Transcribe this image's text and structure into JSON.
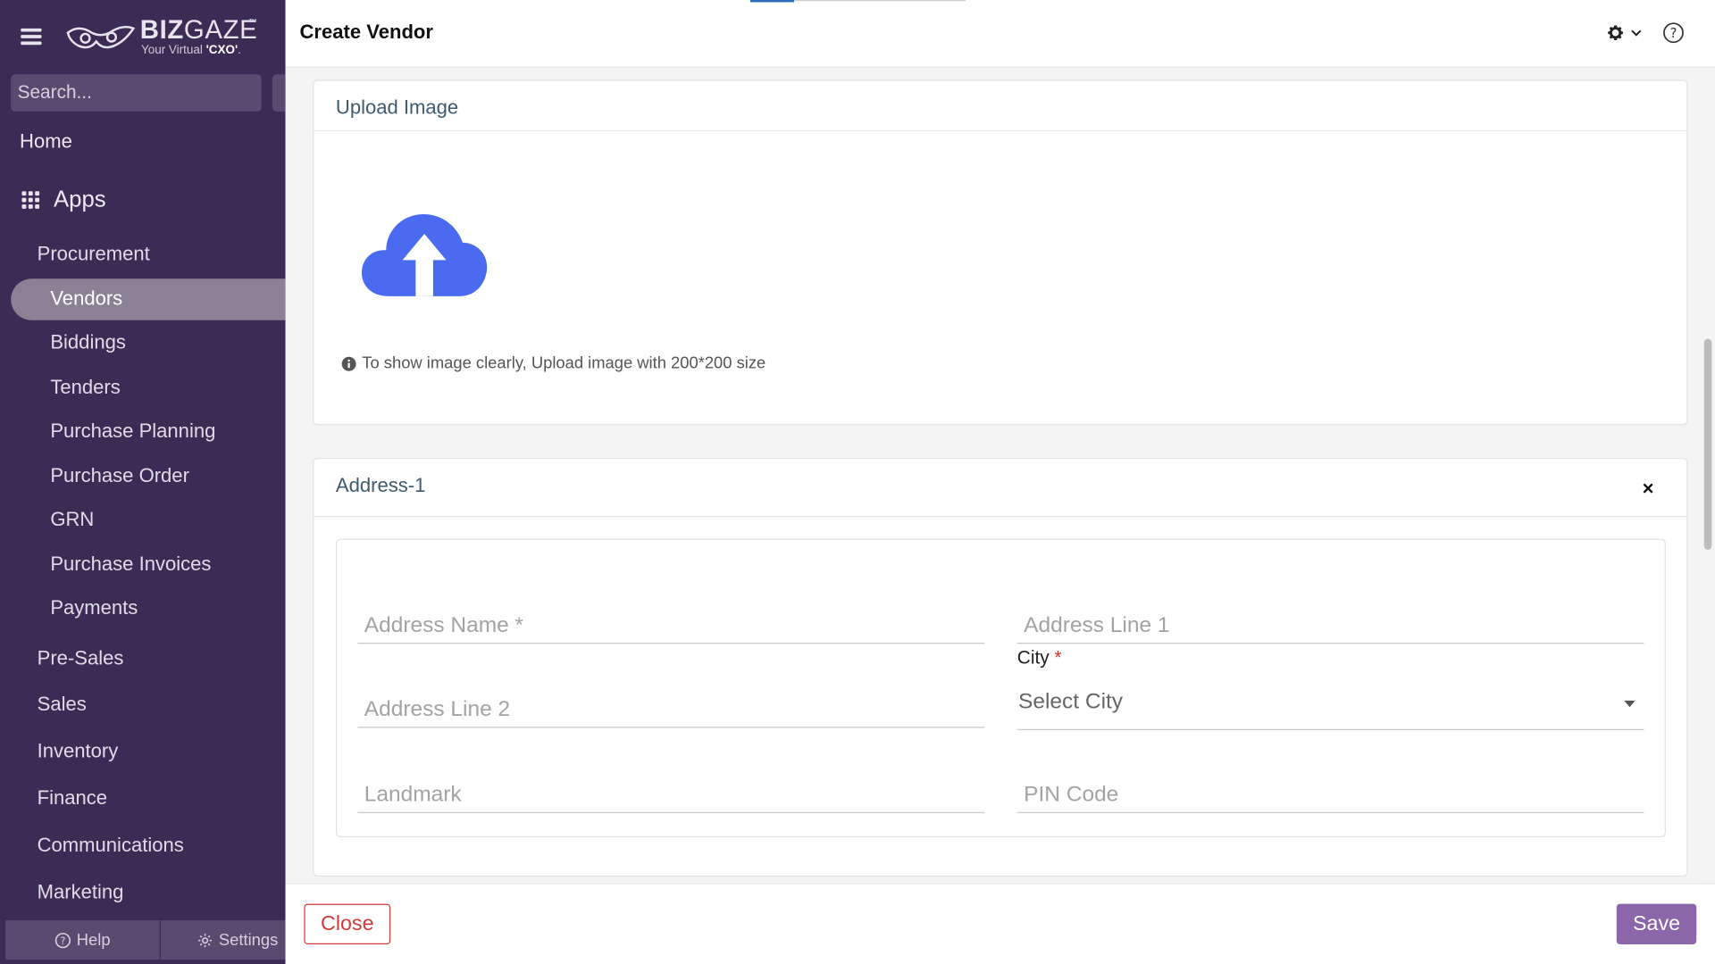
{
  "brand": {
    "name_bold": "BIZ",
    "name_light": "GAZE",
    "trademark": "™",
    "tagline_prefix": "Your Virtual ",
    "tagline_bold": "'CXO'",
    "tagline_suffix": "."
  },
  "search": {
    "placeholder": "Search..."
  },
  "nav": {
    "home": "Home",
    "apps": "Apps",
    "procurement": "Procurement",
    "procurement_items": [
      "Vendors",
      "Biddings",
      "Tenders",
      "Purchase Planning",
      "Purchase Order",
      "GRN",
      "Purchase Invoices",
      "Payments"
    ],
    "active_item": "Vendors",
    "modules": [
      "Pre-Sales",
      "Sales",
      "Inventory",
      "Finance",
      "Communications",
      "Marketing"
    ]
  },
  "footer": {
    "help": "Help",
    "settings": "Settings"
  },
  "page": {
    "title": "Create Vendor"
  },
  "upload": {
    "section_title": "Upload Image",
    "hint": "To show image clearly, Upload image with 200*200 size"
  },
  "address": {
    "section_title": "Address-1",
    "close_symbol": "×",
    "address_name_placeholder": "Address Name *",
    "address_line1_placeholder": "Address Line 1",
    "address_line2_placeholder": "Address Line 2",
    "city_label": "City",
    "city_required_mark": "*",
    "city_select_text": "Select City",
    "landmark_placeholder": "Landmark",
    "pincode_placeholder": "PIN Code"
  },
  "actions": {
    "close": "Close",
    "save": "Save"
  },
  "colors": {
    "sidebar_bg": "#3c2c55",
    "active_item_bg": "#8a8195",
    "upload_icon": "#4a6af0",
    "close_button": "#d23a3a",
    "save_button": "#8b66a8"
  }
}
